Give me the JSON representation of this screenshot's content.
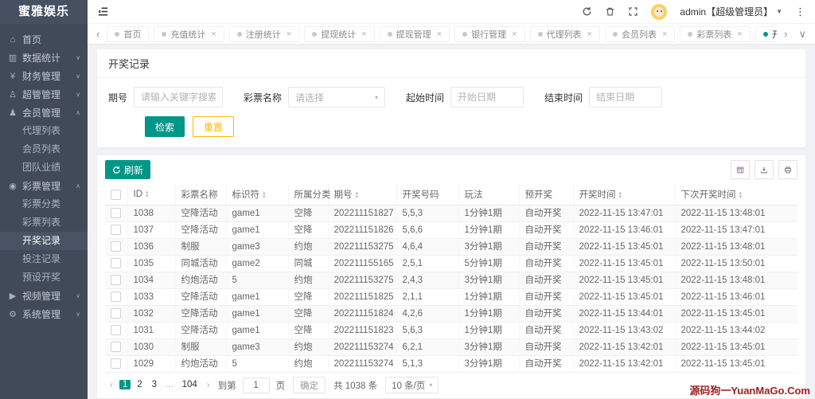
{
  "brand": {
    "logo_text": "蜜雅娱乐"
  },
  "colors": {
    "accent": "#009688",
    "warning": "#ffb800",
    "sidebar_bg": "#414a59",
    "watermark_red": "#9c1f1f",
    "avatar_yellow": "#f6d35d"
  },
  "header": {
    "icons": [
      "collapse-sidebar-icon",
      "refresh-icon",
      "trash-icon",
      "fullscreen-icon",
      "more-vert-icon"
    ],
    "user": {
      "name": "admin【超级管理员】"
    }
  },
  "tabbar": {
    "tabs": [
      {
        "label": "首页",
        "closable": false,
        "active": false
      },
      {
        "label": "充值统计",
        "closable": true,
        "active": false
      },
      {
        "label": "注册统计",
        "closable": true,
        "active": false
      },
      {
        "label": "提现统计",
        "closable": true,
        "active": false
      },
      {
        "label": "提现管理",
        "closable": true,
        "active": false
      },
      {
        "label": "银行管理",
        "closable": true,
        "active": false
      },
      {
        "label": "代理列表",
        "closable": true,
        "active": false
      },
      {
        "label": "会员列表",
        "closable": true,
        "active": false
      },
      {
        "label": "彩票列表",
        "closable": true,
        "active": false
      },
      {
        "label": "开奖记录",
        "closable": true,
        "active": true
      }
    ]
  },
  "sidebar": {
    "items": [
      {
        "label": "首页",
        "icon": "home-icon",
        "expand": null,
        "children": []
      },
      {
        "label": "数据统计",
        "icon": "chart-icon",
        "expand": "down",
        "children": []
      },
      {
        "label": "财务管理",
        "icon": "finance-icon",
        "expand": "down",
        "children": []
      },
      {
        "label": "超管管理",
        "icon": "supervisor-icon",
        "expand": "down",
        "children": []
      },
      {
        "label": "会员管理",
        "icon": "members-icon",
        "expand": "up",
        "children": [
          {
            "label": "代理列表",
            "active": false
          },
          {
            "label": "会员列表",
            "active": false
          },
          {
            "label": "团队业绩",
            "active": false
          }
        ]
      },
      {
        "label": "彩票管理",
        "icon": "lottery-icon",
        "expand": "up",
        "children": [
          {
            "label": "彩票分类",
            "active": false
          },
          {
            "label": "彩票列表",
            "active": false
          },
          {
            "label": "开奖记录",
            "active": true
          },
          {
            "label": "投注记录",
            "active": false
          },
          {
            "label": "预设开奖",
            "active": false
          }
        ]
      },
      {
        "label": "视频管理",
        "icon": "video-icon",
        "expand": "down",
        "children": []
      },
      {
        "label": "系统管理",
        "icon": "system-icon",
        "expand": "down",
        "children": []
      }
    ]
  },
  "page": {
    "title": "开奖记录"
  },
  "filter": {
    "fields": [
      {
        "name": "issue-search-input",
        "label": "期号",
        "type": "input",
        "placeholder": "请输入关键字搜索",
        "width": "w110"
      },
      {
        "name": "lottery-name-select",
        "label": "彩票名称",
        "type": "select",
        "placeholder": "请选择"
      },
      {
        "name": "start-date-input",
        "label": "起始时间",
        "type": "input",
        "placeholder": "开始日期",
        "width": "w90"
      },
      {
        "name": "end-date-input",
        "label": "结束时间",
        "type": "input",
        "placeholder": "结束日期",
        "width": "w90"
      }
    ],
    "search_label": "检索",
    "reset_label": "重置"
  },
  "toolbar": {
    "refresh_label": "刷新",
    "icon_buttons": [
      "columns-icon",
      "export-icon",
      "print-icon"
    ]
  },
  "table": {
    "columns": [
      {
        "key": "id",
        "label": "ID",
        "sortable": true
      },
      {
        "key": "lottery_name",
        "label": "彩票名称",
        "sortable": false
      },
      {
        "key": "identifier",
        "label": "标识符",
        "sortable": true
      },
      {
        "key": "category",
        "label": "所属分类",
        "sortable": false
      },
      {
        "key": "issue",
        "label": "期号",
        "sortable": true
      },
      {
        "key": "numbers",
        "label": "开奖号码",
        "sortable": false
      },
      {
        "key": "play",
        "label": "玩法",
        "sortable": false
      },
      {
        "key": "pre_draw",
        "label": "预开奖",
        "sortable": false
      },
      {
        "key": "draw_time",
        "label": "开奖时间",
        "sortable": true
      },
      {
        "key": "next_draw_time",
        "label": "下次开奖时间",
        "sortable": true
      }
    ],
    "rows": [
      [
        "1038",
        "空降活动",
        "game1",
        "空降",
        "202211151827",
        "5,5,3",
        "1分钟1期",
        "自动开奖",
        "2022-11-15 13:47:01",
        "2022-11-15 13:48:01"
      ],
      [
        "1037",
        "空降活动",
        "game1",
        "空降",
        "202211151826",
        "5,6,6",
        "1分钟1期",
        "自动开奖",
        "2022-11-15 13:46:01",
        "2022-11-15 13:47:01"
      ],
      [
        "1036",
        "制服",
        "game3",
        "约炮",
        "202211153275",
        "4,6,4",
        "3分钟1期",
        "自动开奖",
        "2022-11-15 13:45:01",
        "2022-11-15 13:48:01"
      ],
      [
        "1035",
        "同城活动",
        "game2",
        "同城",
        "202211155165",
        "2,5,1",
        "5分钟1期",
        "自动开奖",
        "2022-11-15 13:45:01",
        "2022-11-15 13:50:01"
      ],
      [
        "1034",
        "约炮活动",
        "5",
        "约炮",
        "202211153275",
        "2,4,3",
        "3分钟1期",
        "自动开奖",
        "2022-11-15 13:45:01",
        "2022-11-15 13:48:01"
      ],
      [
        "1033",
        "空降活动",
        "game1",
        "空降",
        "202211151825",
        "2,1,1",
        "1分钟1期",
        "自动开奖",
        "2022-11-15 13:45:01",
        "2022-11-15 13:46:01"
      ],
      [
        "1032",
        "空降活动",
        "game1",
        "空降",
        "202211151824",
        "4,2,6",
        "1分钟1期",
        "自动开奖",
        "2022-11-15 13:44:01",
        "2022-11-15 13:45:01"
      ],
      [
        "1031",
        "空降活动",
        "game1",
        "空降",
        "202211151823",
        "5,6,3",
        "1分钟1期",
        "自动开奖",
        "2022-11-15 13:43:02",
        "2022-11-15 13:44:02"
      ],
      [
        "1030",
        "制服",
        "game3",
        "约炮",
        "202211153274",
        "6,2,1",
        "3分钟1期",
        "自动开奖",
        "2022-11-15 13:42:01",
        "2022-11-15 13:45:01"
      ],
      [
        "1029",
        "约炮活动",
        "5",
        "约炮",
        "202211153274",
        "5,1,3",
        "3分钟1期",
        "自动开奖",
        "2022-11-15 13:42:01",
        "2022-11-15 13:45:01"
      ]
    ]
  },
  "pagination": {
    "pages": [
      "1",
      "2",
      "3",
      "…",
      "104"
    ],
    "active_page": "1",
    "goto_label": "到第",
    "goto_value": "1",
    "page_unit": "页",
    "confirm_label": "确定",
    "total_text": "共 1038 条",
    "page_size": "10 条/页"
  },
  "watermark": "源码狗一YuanMaGo.Com"
}
